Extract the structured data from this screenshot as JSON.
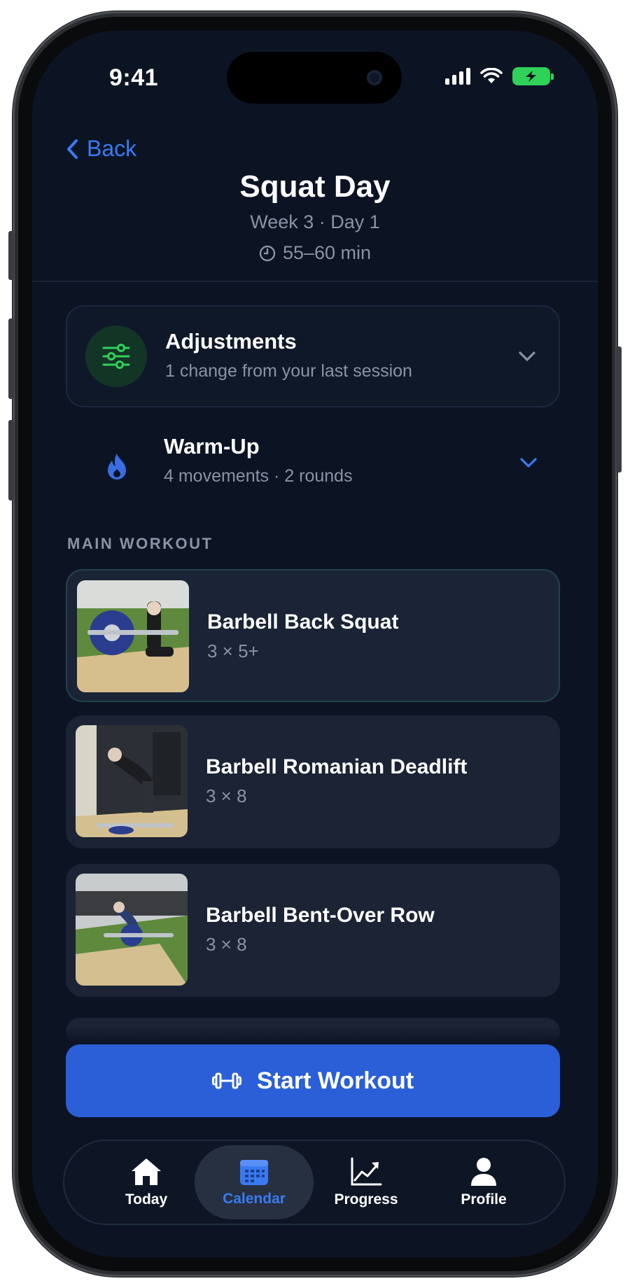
{
  "status_bar": {
    "time": "9:41"
  },
  "header": {
    "back_label": "Back",
    "title": "Squat Day",
    "subtitle": "Week 3 · Day 1",
    "duration": "55–60 min"
  },
  "adjustments": {
    "title": "Adjustments",
    "subtitle": "1 change from your last session",
    "icon": "sliders-icon"
  },
  "warmup": {
    "title": "Warm-Up",
    "subtitle": "4 movements · 2 rounds",
    "icon": "flame-icon"
  },
  "main_workout": {
    "label": "MAIN WORKOUT",
    "exercises": [
      {
        "name": "Barbell Back Squat",
        "sets": "3 × 5+"
      },
      {
        "name": "Barbell Romanian Deadlift",
        "sets": "3 × 8"
      },
      {
        "name": "Barbell Bent-Over Row",
        "sets": "3 × 8"
      }
    ]
  },
  "start_button": {
    "label": "Start Workout",
    "icon": "dumbbell-icon"
  },
  "tabbar": {
    "tabs": [
      {
        "label": "Today",
        "icon": "home-icon"
      },
      {
        "label": "Calendar",
        "icon": "calendar-icon",
        "active": true
      },
      {
        "label": "Progress",
        "icon": "chart-icon"
      },
      {
        "label": "Profile",
        "icon": "person-icon"
      }
    ]
  },
  "colors": {
    "background": "#0c1424",
    "card": "#1b2335",
    "accent": "#2a5fd8",
    "link": "#3a7af0",
    "green": "#2fd158",
    "muted_text": "#8a93a3"
  }
}
